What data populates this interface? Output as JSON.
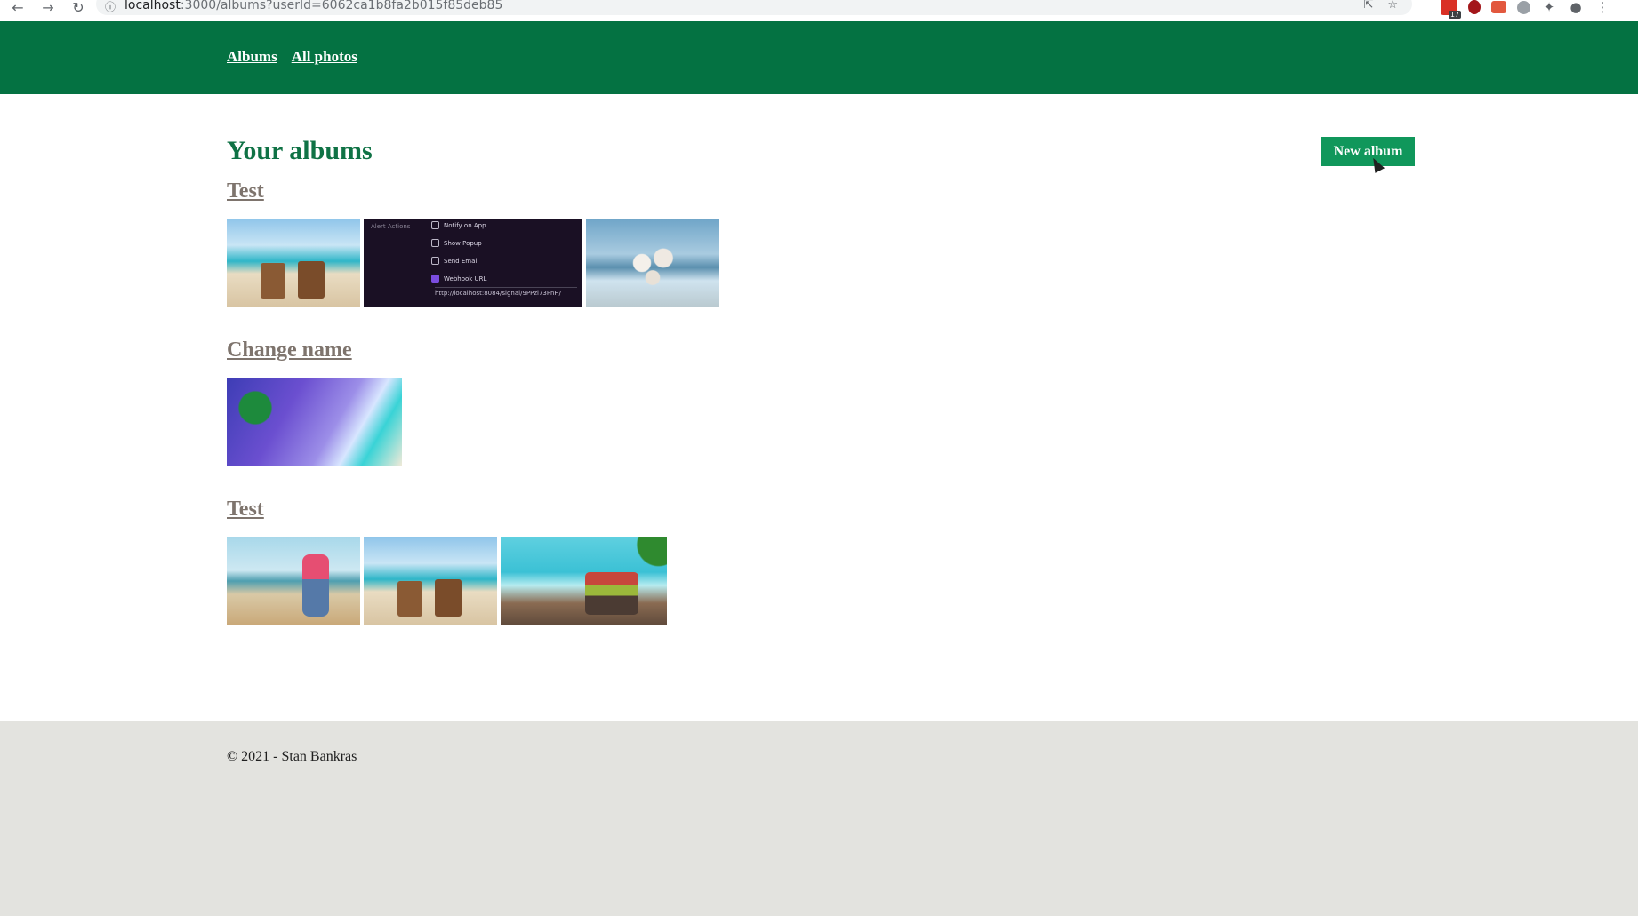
{
  "browser": {
    "url_host": "localhost",
    "url_rest": ":3000/albums?userId=6062ca1b8fa2b015f85deb85",
    "nav_back": "←",
    "nav_forward": "→",
    "nav_reload": "↻",
    "extension_badge": "17"
  },
  "header": {
    "nav": [
      {
        "label": "Albums"
      },
      {
        "label": "All photos"
      }
    ]
  },
  "main": {
    "title": "Your albums",
    "new_album_label": "New album",
    "albums": [
      {
        "name": "Test"
      },
      {
        "name": "Change name"
      },
      {
        "name": "Test"
      }
    ],
    "screenshot_thumb": {
      "section_label": "Alert Actions",
      "options": [
        "Notify on App",
        "Show Popup",
        "Send Email",
        "Webhook URL"
      ],
      "webhook_url": "http://localhost:8084/signal/9PPzi73PnH/"
    }
  },
  "footer": {
    "text": "© 2021 - Stan Bankras"
  },
  "colors": {
    "header_bg": "#047242",
    "accent_button": "#10975b",
    "title_green": "#0f7245",
    "album_link": "#7e746d",
    "footer_bg": "#e3e3df"
  }
}
